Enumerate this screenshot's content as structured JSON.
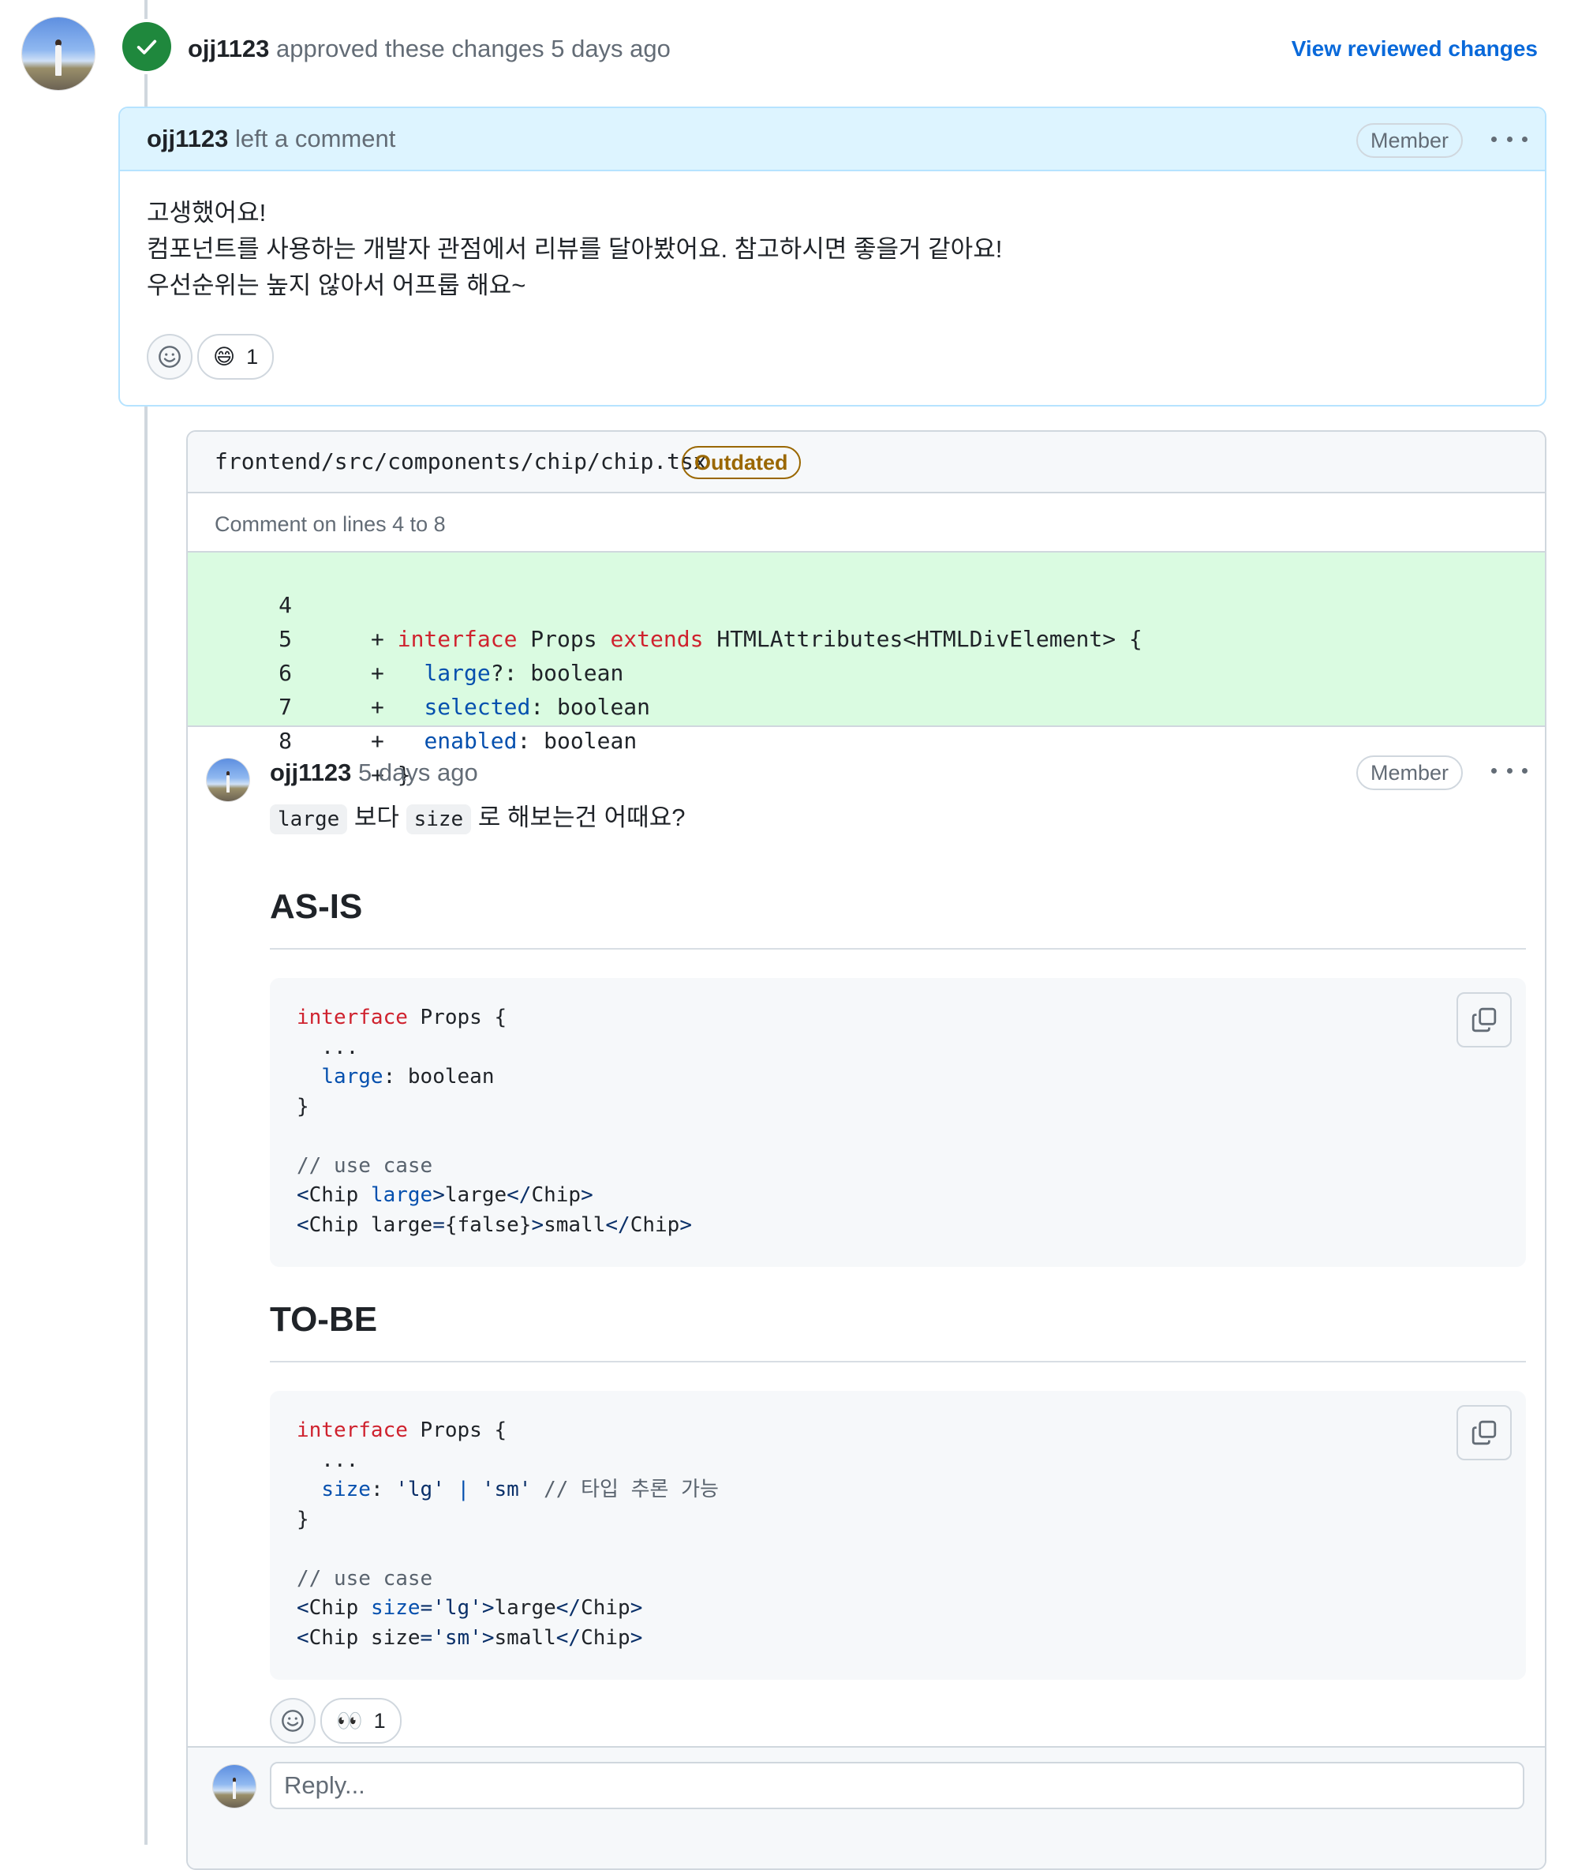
{
  "review": {
    "author": "ojj1123",
    "action": "approved these changes",
    "time": "5 days ago",
    "view_link": "View reviewed changes",
    "status_color": "#1f883d"
  },
  "review_comment": {
    "author": "ojj1123",
    "action": "left a comment",
    "role": "Member",
    "body_lines": [
      "고생했어요!",
      "컴포넌트를 사용하는 개발자 관점에서 리뷰를 달아봤어요. 참고하시면 좋을거 같아요!",
      "우선순위는 높지 않아서 어프룹 해요~"
    ],
    "reactions": [
      {
        "emoji": "😄",
        "count": "1"
      }
    ]
  },
  "file_thread": {
    "path": "frontend/src/components/chip/chip.tsx",
    "badge": "Outdated",
    "comment_range": "Comment on lines 4 to 8",
    "diff_lines": [
      {
        "num": "4",
        "sign": "+"
      },
      {
        "num": "5",
        "sign": "+"
      },
      {
        "num": "6",
        "sign": "+"
      },
      {
        "num": "7",
        "sign": "+"
      },
      {
        "num": "8",
        "sign": "+"
      }
    ]
  },
  "inline_comment": {
    "author": "ojj1123",
    "time": "5 days ago",
    "role": "Member",
    "chip_large": "large",
    "text_1": "보다",
    "chip_size": "size",
    "text_2": "로 해보는건 어때요?",
    "heading_asis": "AS-IS",
    "heading_tobe": "TO-BE",
    "reactions": [
      {
        "emoji": "👀",
        "count": "1"
      }
    ]
  },
  "reply": {
    "placeholder": "Reply..."
  },
  "icons": {
    "approve": "check-icon",
    "add_reaction": "smiley-icon",
    "copy": "copy-icon",
    "more": "kebab-horizontal-icon"
  }
}
